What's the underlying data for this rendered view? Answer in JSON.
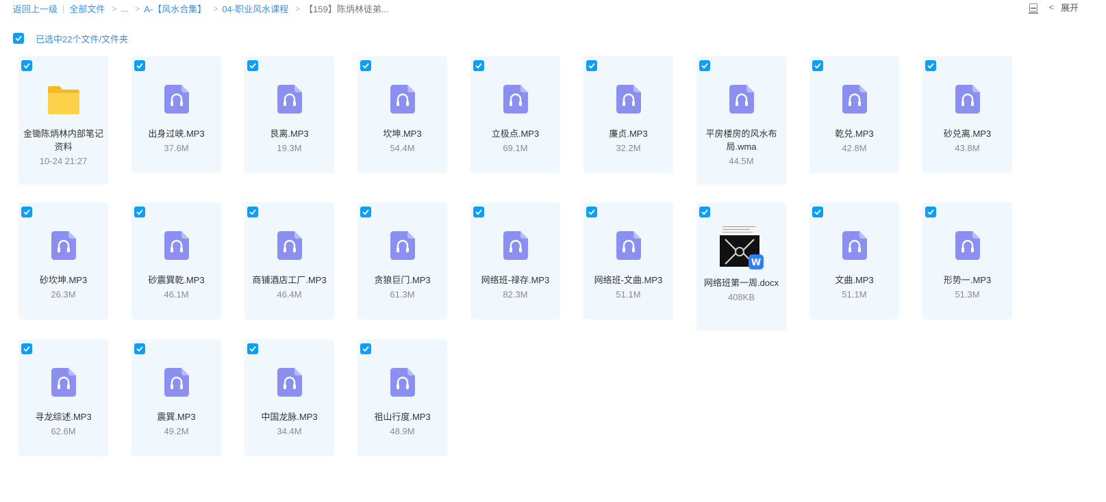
{
  "breadcrumb": {
    "back": "返回上一级",
    "all_files": "全部文件",
    "ellipsis": "...",
    "level1": "A-【风水合集】",
    "level2": "04-职业风水课程",
    "current": "【159】陈炳林徒弟..."
  },
  "header": {
    "expand_label": "展开"
  },
  "selection": {
    "text": "已选中22个文件/文件夹"
  },
  "files": [
    {
      "name": "金锄陈炳林内部笔记资料",
      "meta": "10-24 21:27",
      "type": "folder"
    },
    {
      "name": "出身过峡.MP3",
      "meta": "37.6M",
      "type": "audio"
    },
    {
      "name": "艮离.MP3",
      "meta": "19.3M",
      "type": "audio"
    },
    {
      "name": "坎坤.MP3",
      "meta": "54.4M",
      "type": "audio"
    },
    {
      "name": "立极点.MP3",
      "meta": "69.1M",
      "type": "audio"
    },
    {
      "name": "廉贞.MP3",
      "meta": "32.2M",
      "type": "audio"
    },
    {
      "name": "平房楼房的风水布局.wma",
      "meta": "44.5M",
      "type": "audio"
    },
    {
      "name": "乾兑.MP3",
      "meta": "42.8M",
      "type": "audio"
    },
    {
      "name": "砂兑离.MP3",
      "meta": "43.8M",
      "type": "audio"
    },
    {
      "name": "砂坎坤.MP3",
      "meta": "26.3M",
      "type": "audio"
    },
    {
      "name": "砂震巽乾.MP3",
      "meta": "46.1M",
      "type": "audio"
    },
    {
      "name": "商铺酒店工厂.MP3",
      "meta": "46.4M",
      "type": "audio"
    },
    {
      "name": "贪狼巨门.MP3",
      "meta": "61.3M",
      "type": "audio"
    },
    {
      "name": "网络班-禄存.MP3",
      "meta": "82.3M",
      "type": "audio"
    },
    {
      "name": "网络班-文曲.MP3",
      "meta": "51.1M",
      "type": "audio"
    },
    {
      "name": "网络班第一周.docx",
      "meta": "408KB",
      "type": "doc"
    },
    {
      "name": "文曲.MP3",
      "meta": "51.1M",
      "type": "audio"
    },
    {
      "name": "形势一.MP3",
      "meta": "51.3M",
      "type": "audio"
    },
    {
      "name": "寻龙综述.MP3",
      "meta": "62.6M",
      "type": "audio"
    },
    {
      "name": "震巽.MP3",
      "meta": "49.2M",
      "type": "audio"
    },
    {
      "name": "中国龙脉.MP3",
      "meta": "34.4M",
      "type": "audio"
    },
    {
      "name": "祖山行度.MP3",
      "meta": "48.9M",
      "type": "audio"
    }
  ],
  "colors": {
    "accent": "#0e9ff2",
    "link": "#3a8ee6",
    "card_bg": "#f1f8fd",
    "audio_icon": "#8a8ff0",
    "folder": "#f9c52a"
  },
  "icons": {
    "folder": "folder-icon",
    "audio": "audio-file-icon",
    "doc": "word-doc-icon",
    "check": "check-icon",
    "list_view": "list-view-icon",
    "expand_chevron": "chevron-left-icon"
  }
}
